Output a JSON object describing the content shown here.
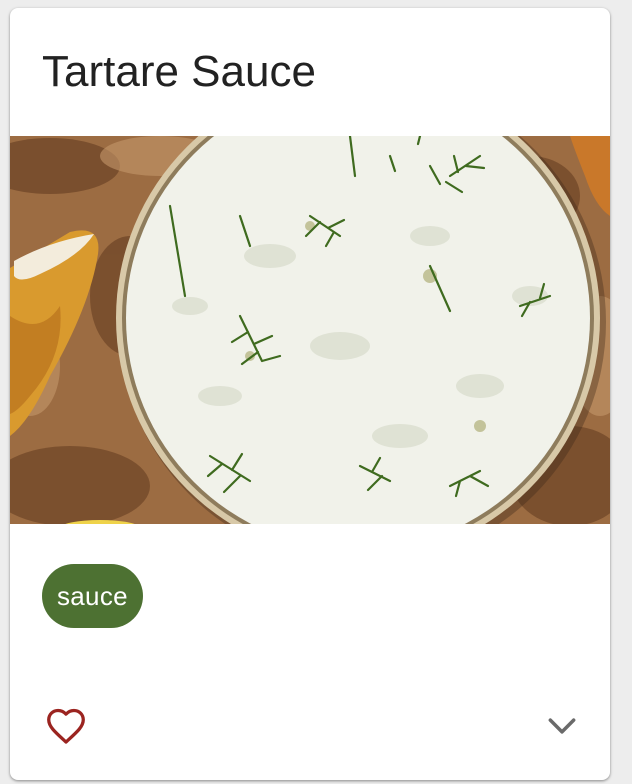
{
  "card": {
    "title": "Tartare Sauce",
    "image_alt": "Bowl of tartare sauce topped with fresh dill, beside fried fish",
    "tags": [
      "sauce"
    ],
    "actions": {
      "favorite_icon": "heart-outline-icon",
      "expand_icon": "chevron-down-icon"
    }
  },
  "colors": {
    "chip_background": "#4d7132",
    "favorite_icon": "#9b2420",
    "expand_icon": "#6a6a6a",
    "title_text": "#222222"
  }
}
